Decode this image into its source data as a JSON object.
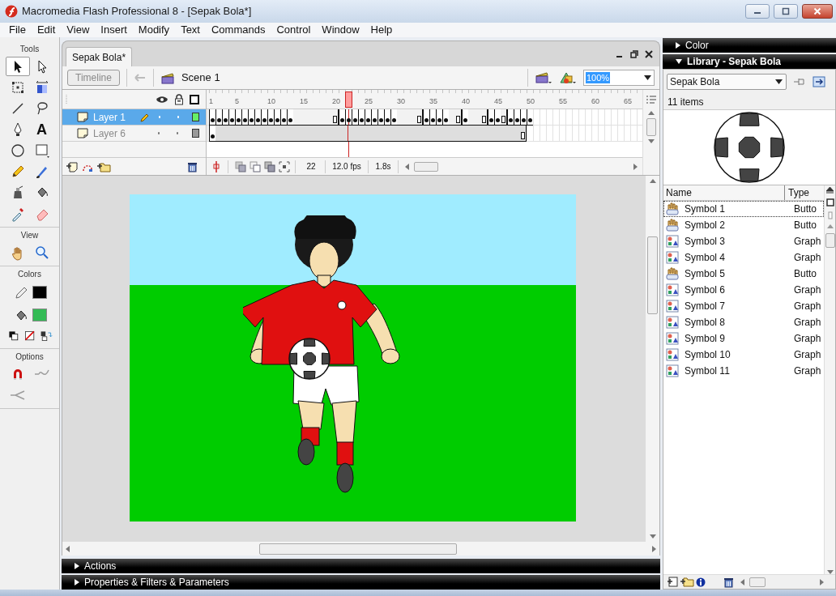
{
  "window": {
    "title": "Macromedia Flash Professional 8 - [Sepak Bola*]"
  },
  "menu": [
    "File",
    "Edit",
    "View",
    "Insert",
    "Modify",
    "Text",
    "Commands",
    "Control",
    "Window",
    "Help"
  ],
  "tool_sections": [
    {
      "title": "Tools",
      "tools": [
        {
          "kind": "arrow",
          "selected": true
        },
        {
          "kind": "subselect",
          "selected": false
        },
        {
          "kind": "free-transform",
          "selected": false
        },
        {
          "kind": "fill-transform",
          "selected": false
        },
        {
          "kind": "line",
          "selected": false
        },
        {
          "kind": "lasso",
          "selected": false
        },
        {
          "kind": "pen",
          "selected": false
        },
        {
          "kind": "text",
          "glyph": "A",
          "selected": false
        },
        {
          "kind": "oval",
          "selected": false
        },
        {
          "kind": "rectangle",
          "selected": false
        },
        {
          "kind": "pencil",
          "selected": false
        },
        {
          "kind": "brush",
          "selected": false
        },
        {
          "kind": "ink-bottle",
          "selected": false
        },
        {
          "kind": "paint-bucket",
          "selected": false
        },
        {
          "kind": "eyedropper",
          "selected": false
        },
        {
          "kind": "eraser",
          "selected": false
        }
      ]
    },
    {
      "title": "View",
      "tools": [
        {
          "kind": "hand",
          "selected": false
        },
        {
          "kind": "zoom",
          "selected": false
        }
      ]
    },
    {
      "title": "Colors",
      "tools": [
        {
          "kind": "stroke-color",
          "color": "#000000"
        },
        {
          "kind": "fill-color",
          "color": "#33bb55"
        },
        {
          "kind": "default-colors"
        },
        {
          "kind": "no-color"
        },
        {
          "kind": "swap-colors"
        }
      ]
    },
    {
      "title": "Options",
      "tools": [
        {
          "kind": "snap",
          "disabled": false
        },
        {
          "kind": "smooth",
          "disabled": true
        },
        {
          "kind": "straighten",
          "disabled": true
        }
      ]
    }
  ],
  "document": {
    "tab": "Sepak Bola*",
    "timeline_button": "Timeline",
    "scene": "Scene 1",
    "zoom": "100%"
  },
  "timeline": {
    "ruler": [
      "1",
      "5",
      "10",
      "15",
      "20",
      "25",
      "30",
      "35",
      "40",
      "45",
      "50",
      "55",
      "60",
      "65"
    ],
    "current_frame": "22",
    "frame_rate": "12.0 fps",
    "elapsed": "1.8s",
    "layers": [
      {
        "name": "Layer 1",
        "selected": true,
        "editing": true,
        "color": "#66ee66",
        "frames": [
          {
            "kind": "key"
          },
          {
            "kind": "key"
          },
          {
            "kind": "key"
          },
          {
            "kind": "key"
          },
          {
            "kind": "key"
          },
          {
            "kind": "key"
          },
          {
            "kind": "key"
          },
          {
            "kind": "key"
          },
          {
            "kind": "key"
          },
          {
            "kind": "key"
          },
          {
            "kind": "key"
          },
          {
            "kind": "key"
          },
          {
            "kind": "key"
          },
          {
            "kind": "frame"
          },
          {
            "kind": "frame"
          },
          {
            "kind": "frame"
          },
          {
            "kind": "frame"
          },
          {
            "kind": "frame"
          },
          {
            "kind": "frame"
          },
          {
            "kind": "end"
          },
          {
            "kind": "key"
          },
          {
            "kind": "key"
          },
          {
            "kind": "key"
          },
          {
            "kind": "key"
          },
          {
            "kind": "key"
          },
          {
            "kind": "key"
          },
          {
            "kind": "key"
          },
          {
            "kind": "key"
          },
          {
            "kind": "key"
          },
          {
            "kind": "frame"
          },
          {
            "kind": "frame"
          },
          {
            "kind": "frame"
          },
          {
            "kind": "end"
          },
          {
            "kind": "key"
          },
          {
            "kind": "key"
          },
          {
            "kind": "key"
          },
          {
            "kind": "key"
          },
          {
            "kind": "frame"
          },
          {
            "kind": "end"
          },
          {
            "kind": "key"
          },
          {
            "kind": "frame"
          },
          {
            "kind": "frame"
          },
          {
            "kind": "end"
          },
          {
            "kind": "key"
          },
          {
            "kind": "key"
          },
          {
            "kind": "end"
          },
          {
            "kind": "key"
          },
          {
            "kind": "key"
          },
          {
            "kind": "key"
          },
          {
            "kind": "key"
          }
        ]
      },
      {
        "name": "Layer 6",
        "selected": false,
        "editing": false,
        "color": "#999999",
        "frames": [
          {
            "kind": "key"
          },
          {
            "kind": "frame"
          },
          {
            "kind": "frame"
          },
          {
            "kind": "frame"
          },
          {
            "kind": "frame"
          },
          {
            "kind": "frame"
          },
          {
            "kind": "frame"
          },
          {
            "kind": "frame"
          },
          {
            "kind": "frame"
          },
          {
            "kind": "frame"
          },
          {
            "kind": "frame"
          },
          {
            "kind": "frame"
          },
          {
            "kind": "frame"
          },
          {
            "kind": "frame"
          },
          {
            "kind": "frame"
          },
          {
            "kind": "frame"
          },
          {
            "kind": "frame"
          },
          {
            "kind": "frame"
          },
          {
            "kind": "frame"
          },
          {
            "kind": "frame"
          },
          {
            "kind": "frame"
          },
          {
            "kind": "frame"
          },
          {
            "kind": "frame"
          },
          {
            "kind": "frame"
          },
          {
            "kind": "frame"
          },
          {
            "kind": "frame"
          },
          {
            "kind": "frame"
          },
          {
            "kind": "frame"
          },
          {
            "kind": "frame"
          },
          {
            "kind": "frame"
          },
          {
            "kind": "frame"
          },
          {
            "kind": "frame"
          },
          {
            "kind": "frame"
          },
          {
            "kind": "frame"
          },
          {
            "kind": "frame"
          },
          {
            "kind": "frame"
          },
          {
            "kind": "frame"
          },
          {
            "kind": "frame"
          },
          {
            "kind": "frame"
          },
          {
            "kind": "frame"
          },
          {
            "kind": "frame"
          },
          {
            "kind": "frame"
          },
          {
            "kind": "frame"
          },
          {
            "kind": "frame"
          },
          {
            "kind": "frame"
          },
          {
            "kind": "frame"
          },
          {
            "kind": "frame"
          },
          {
            "kind": "frame"
          },
          {
            "kind": "end"
          }
        ]
      }
    ]
  },
  "bottom_panels": [
    {
      "title": "Actions",
      "expanded": false
    },
    {
      "title": "Properties & Filters & Parameters",
      "expanded": false
    }
  ],
  "side_panels": [
    {
      "title": "Color",
      "expanded": false
    },
    {
      "title": "Library - Sepak Bola",
      "expanded": true
    }
  ],
  "library": {
    "document": "Sepak Bola",
    "count": "11 items",
    "columns": [
      "Name",
      "Type"
    ],
    "items": [
      {
        "kind": "button",
        "name": "Symbol 1",
        "type": "Butto",
        "selected": true
      },
      {
        "kind": "button",
        "name": "Symbol 2",
        "type": "Butto",
        "selected": false
      },
      {
        "kind": "graphic",
        "name": "Symbol 3",
        "type": "Graph",
        "selected": false
      },
      {
        "kind": "graphic",
        "name": "Symbol 4",
        "type": "Graph",
        "selected": false
      },
      {
        "kind": "button",
        "name": "Symbol 5",
        "type": "Butto",
        "selected": false
      },
      {
        "kind": "graphic",
        "name": "Symbol 6",
        "type": "Graph",
        "selected": false
      },
      {
        "kind": "graphic",
        "name": "Symbol 7",
        "type": "Graph",
        "selected": false
      },
      {
        "kind": "graphic",
        "name": "Symbol 8",
        "type": "Graph",
        "selected": false
      },
      {
        "kind": "graphic",
        "name": "Symbol 9",
        "type": "Graph",
        "selected": false
      },
      {
        "kind": "graphic",
        "name": "Symbol 10",
        "type": "Graph",
        "selected": false
      },
      {
        "kind": "graphic",
        "name": "Symbol 11",
        "type": "Graph",
        "selected": false
      }
    ]
  }
}
